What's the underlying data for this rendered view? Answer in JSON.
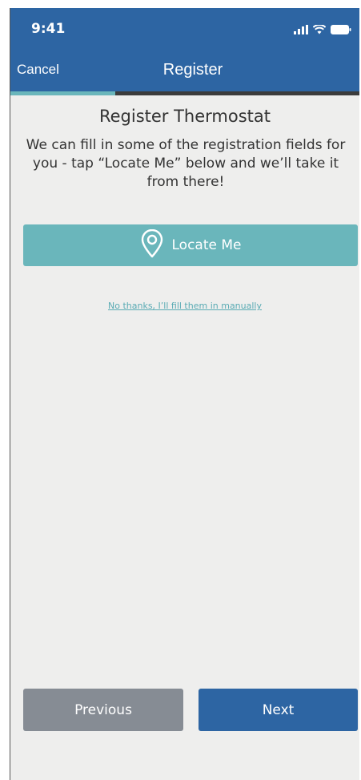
{
  "status_bar": {
    "time": "9:41",
    "icons": [
      "signal-bars-icon",
      "wifi-icon",
      "battery-icon"
    ]
  },
  "nav": {
    "cancel_label": "Cancel",
    "title": "Register"
  },
  "progress": {
    "fraction": 0.3
  },
  "content": {
    "title": "Register Thermostat",
    "subtitle": "We can fill in some of the registration fields for you - tap “Locate Me” below and we’ll take it from there!",
    "locate_button": {
      "label": "Locate Me",
      "icon": "location-pin-icon"
    },
    "manual_link": "No thanks, I’ll fill them in manually"
  },
  "footer": {
    "previous_label": "Previous",
    "next_label": "Next"
  },
  "colors": {
    "header": "#2d65a3",
    "accent": "#6ab6bb",
    "previous_button": "#868c94",
    "next_button": "#2d65a3",
    "background": "#eeeeed"
  }
}
